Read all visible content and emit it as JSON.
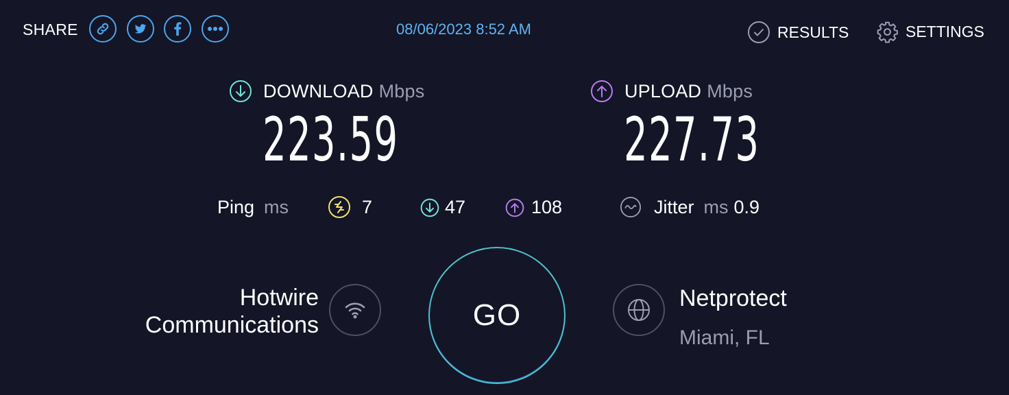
{
  "header": {
    "share_label": "SHARE",
    "share_buttons": [
      {
        "icon": "link-icon"
      },
      {
        "icon": "twitter-icon"
      },
      {
        "icon": "facebook-icon"
      },
      {
        "icon": "more-icon"
      }
    ],
    "timestamp": "08/06/2023 8:52 AM",
    "results_label": "RESULTS",
    "settings_label": "SETTINGS"
  },
  "download": {
    "label": "DOWNLOAD",
    "unit": "Mbps",
    "value": "223.59"
  },
  "upload": {
    "label": "UPLOAD",
    "unit": "Mbps",
    "value": "227.73"
  },
  "ping": {
    "label": "Ping",
    "unit": "ms",
    "idle": "7",
    "download": "47",
    "upload": "108"
  },
  "jitter": {
    "label": "Jitter",
    "unit": "ms",
    "value": "0.9"
  },
  "provider": {
    "name_line1": "Hotwire",
    "name_line2": "Communications"
  },
  "go_label": "GO",
  "server": {
    "name": "Netprotect",
    "location": "Miami, FL"
  },
  "colors": {
    "background": "#141526",
    "share_accent": "#4aa7f0",
    "download_accent": "#6fe3d8",
    "upload_accent": "#b67cf0",
    "ping_idle_accent": "#f2e26b",
    "go_ring": "#4bc2cf",
    "muted_text": "#9b9db0"
  }
}
